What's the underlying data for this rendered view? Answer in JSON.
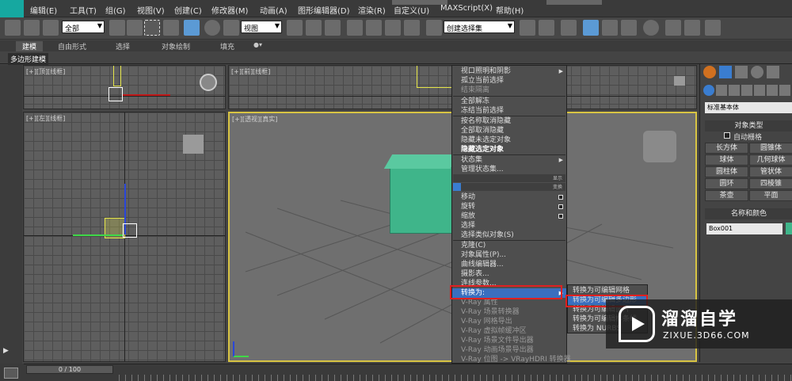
{
  "menubar": {
    "items": [
      "编辑(E)",
      "工具(T)",
      "组(G)",
      "视图(V)",
      "创建(C)",
      "修改器(M)",
      "动画(A)",
      "图形编辑器(D)",
      "渲染(R)",
      "自定义(U)",
      "MAXScript(X)",
      "帮助(H)"
    ]
  },
  "toolbar": {
    "selection_filter": "全部",
    "ref_coord": "视图",
    "named_selection": "创建选择集"
  },
  "ribbon": {
    "tabs": [
      "建模",
      "自由形式",
      "选择",
      "对象绘制",
      "填充"
    ],
    "sub_label": "多边形建模"
  },
  "viewports": {
    "top": "[+][顶][线框]",
    "front": "[+][前][线框]",
    "left": "[+][左][线框]",
    "perspective": "[+][透视][真实]"
  },
  "context_menu": {
    "items": [
      "视口照明和阴影",
      "孤立当前选择",
      "结束隔离",
      "全部解冻",
      "冻结当前选择",
      "按名称取消隐藏",
      "全部取消隐藏",
      "隐藏未选定对象",
      "隐藏选定对象",
      "状态集",
      "管理状态集...",
      "显示",
      "变换",
      "移动",
      "旋转",
      "缩放",
      "选择",
      "选择类似对象(S)",
      "克隆(C)",
      "对象属性(P)...",
      "曲线编辑器...",
      "摄影表...",
      "连线参数...",
      "转换为:",
      "V-Ray 属性",
      "V-Ray 场景转换器",
      "V-Ray 网格导出",
      "V-Ray 虚拟帧缓冲区",
      "V-Ray 场景文件导出器",
      "V-Ray 动画场景导出器",
      "V-Ray 位图 -> VRayHDRI 转换器"
    ]
  },
  "submenu": {
    "items": [
      "转换为可编辑网格",
      "转换为可编辑多边形",
      "转换为可编辑面片",
      "转换为可编辑样条线",
      "转换为 NURBS"
    ]
  },
  "command_panel": {
    "category": "标准基本体",
    "object_type_header": "对象类型",
    "autogrid_label": "自动栅格",
    "buttons": [
      "长方体",
      "圆锥体",
      "球体",
      "几何球体",
      "圆柱体",
      "管状体",
      "圆环",
      "四棱锥",
      "茶壶",
      "平面"
    ],
    "name_color_header": "名称和颜色",
    "object_name": "Box001"
  },
  "timeline": {
    "frame": "0 / 100"
  },
  "watermark": {
    "title": "溜溜自学",
    "url": "ZIXUE.3D66.COM"
  },
  "colors": {
    "accent_blue": "#3a7dd0",
    "highlight_red": "#e02020",
    "box_green": "#3fb58a",
    "viewport_border": "#d8c443"
  }
}
